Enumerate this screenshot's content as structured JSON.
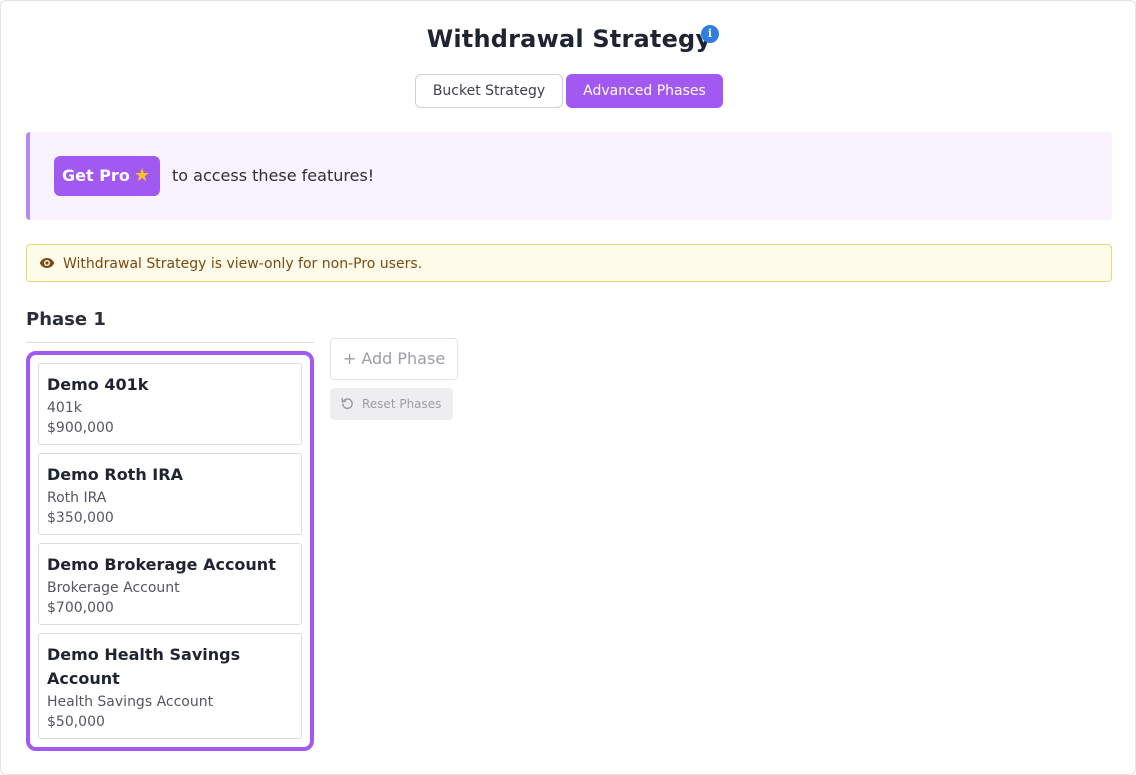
{
  "header": {
    "title": "Withdrawal Strategy",
    "info_icon": "info-icon",
    "info_glyph": "i"
  },
  "tabs": [
    {
      "label": "Bucket Strategy",
      "active": false
    },
    {
      "label": "Advanced Phases",
      "active": true
    }
  ],
  "pro_banner": {
    "button_label": "Get Pro",
    "button_icon": "star-icon",
    "text": "to access these features!"
  },
  "notice": {
    "icon": "eye-icon",
    "text": "Withdrawal Strategy is view-only for non-Pro users."
  },
  "phases": [
    {
      "title": "Phase 1",
      "accounts": [
        {
          "name": "Demo 401k",
          "type": "401k",
          "value": "$900,000"
        },
        {
          "name": "Demo Roth IRA",
          "type": "Roth IRA",
          "value": "$350,000"
        },
        {
          "name": "Demo Brokerage Account",
          "type": "Brokerage Account",
          "value": "$700,000"
        },
        {
          "name": "Demo Health Savings Account",
          "type": "Health Savings Account",
          "value": "$50,000"
        }
      ]
    }
  ],
  "actions": {
    "add_phase_label": "+ Add Phase",
    "reset_phases_label": "Reset Phases",
    "reset_icon": "reset-icon"
  },
  "colors": {
    "accent": "#a259f2",
    "info_blue": "#2f7de1",
    "banner_bg": "#f8f3fd",
    "warning_bg": "#fefbea",
    "warning_border": "#ecd479",
    "warning_text": "#7a4a12",
    "star": "#f7c31c"
  }
}
